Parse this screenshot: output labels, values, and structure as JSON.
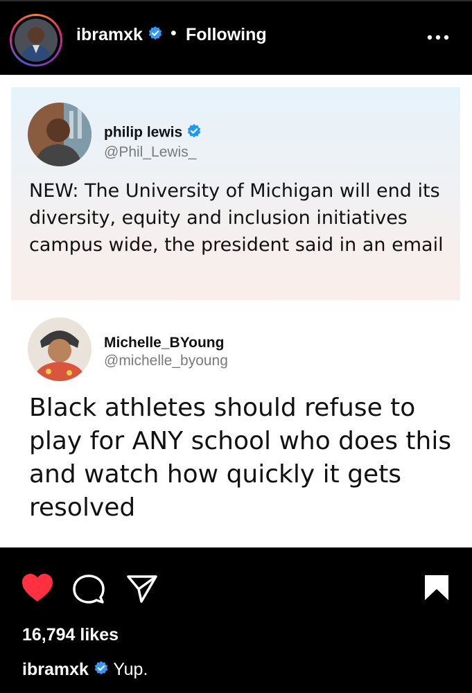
{
  "header": {
    "username": "ibramxk",
    "separator": "•",
    "follow_status": "Following",
    "more_icon": "ellipsis-horizontal-icon",
    "verified_color": "#3897f0"
  },
  "post": {
    "tweets": [
      {
        "name": "philip lewis",
        "handle": "@Phil_Lewis_",
        "verified": true,
        "text": "NEW: The University of Michigan will end its diversity, equity and inclusion initiatives campus wide, the president said in an email"
      },
      {
        "name": "Michelle_BYoung",
        "handle": "@michelle_byoung",
        "verified": false,
        "text": "Black athletes should refuse to play for ANY school who does this and watch how quickly it gets resolved"
      }
    ]
  },
  "actions": {
    "like_icon": "heart-filled-icon",
    "like_color": "#ff3040",
    "comment_icon": "comment-icon",
    "share_icon": "send-icon",
    "save_icon": "bookmark-filled-icon",
    "likes_text": "16,794 likes"
  },
  "caption": {
    "username": "ibramxk",
    "text": "Yup."
  }
}
